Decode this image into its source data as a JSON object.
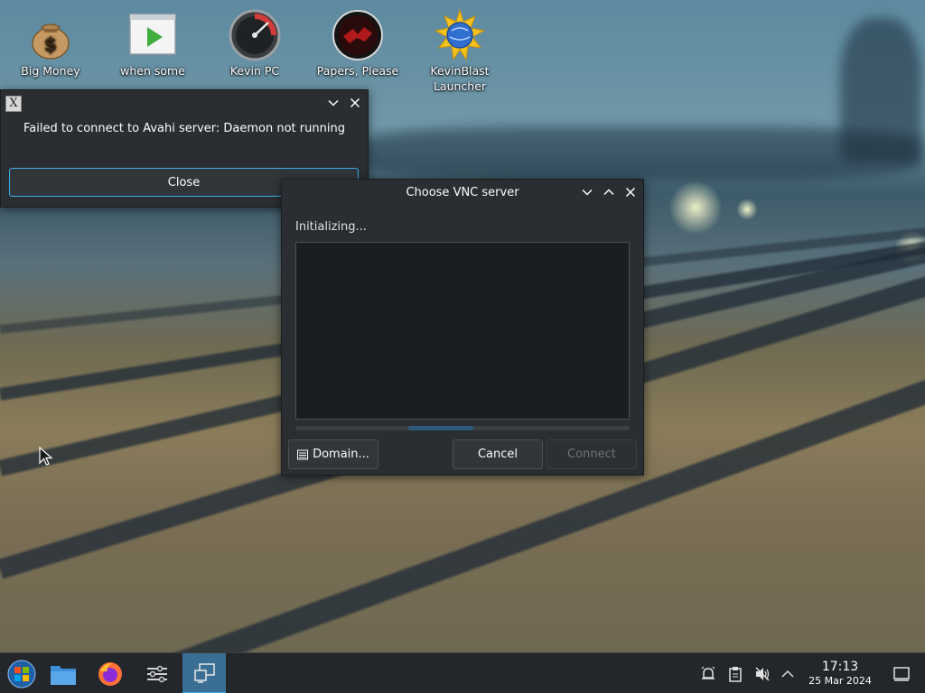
{
  "desktop_icons": [
    {
      "label": "Big Money"
    },
    {
      "label": "when some"
    },
    {
      "label": "Kevin PC"
    },
    {
      "label": "Papers, Please"
    },
    {
      "label": "KevinBlast Launcher"
    }
  ],
  "error_dialog": {
    "message": "Failed to connect to Avahi server: Daemon not running",
    "close_label": "Close"
  },
  "vnc_dialog": {
    "title": "Choose VNC server",
    "status": "Initializing...",
    "domain_label": "Domain...",
    "cancel_label": "Cancel",
    "connect_label": "Connect"
  },
  "clock": {
    "time": "17:13",
    "date": "25 Mar 2024"
  },
  "colors": {
    "accent": "#3daee9",
    "window_bg": "#2a2e32",
    "taskbar_bg": "#23262a"
  }
}
